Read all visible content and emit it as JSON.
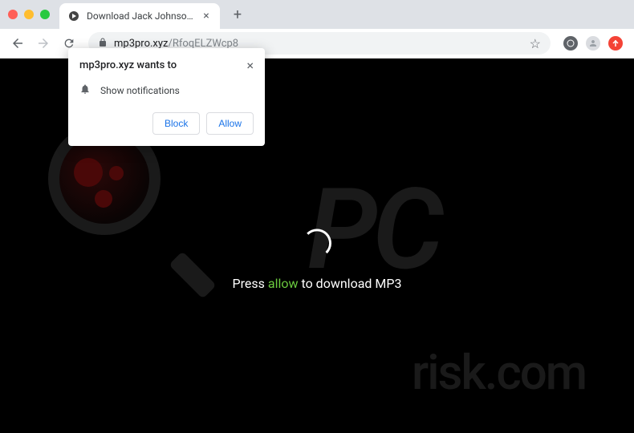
{
  "tab": {
    "title": "Download Jack Johnson - Bett",
    "close_glyph": "×"
  },
  "new_tab_glyph": "+",
  "url": {
    "host": "mp3pro.xyz",
    "path": "/RfoqELZWcp8"
  },
  "permission": {
    "title": "mp3pro.xyz wants to",
    "text": "Show notifications",
    "block": "Block",
    "allow": "Allow",
    "close_glyph": "×"
  },
  "page": {
    "press": "Press ",
    "allow": "allow",
    "rest": " to download MP3"
  },
  "watermark": {
    "pc": "PC",
    "risk": "risk.com"
  }
}
